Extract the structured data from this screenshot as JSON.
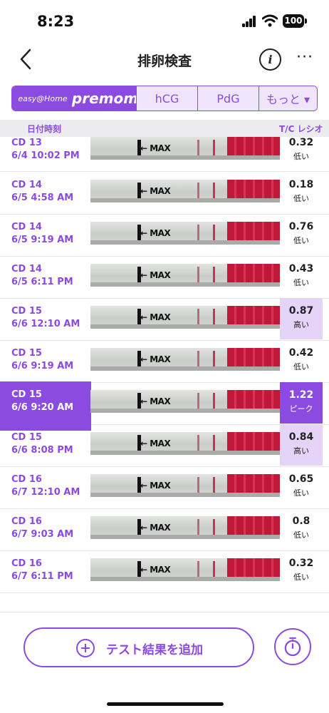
{
  "status_bar": {
    "time": "8:23",
    "battery": "100"
  },
  "header": {
    "title": "排卵検査",
    "info_label": "i",
    "more_label": "···"
  },
  "tabs": [
    {
      "label": "easy@Home",
      "active": true
    },
    {
      "label": "premom",
      "active": true
    },
    {
      "label": "hCG",
      "active": false
    },
    {
      "label": "PdG",
      "active": false
    },
    {
      "label": "もっと ▾",
      "active": false
    }
  ],
  "columns": {
    "date": "日付時刻",
    "ratio": "T/C レシオ"
  },
  "strip_text": {
    "max": "MAX"
  },
  "colors": {
    "accent": "#8c4be0",
    "high_bg": "#e6d4f8",
    "peak_bg": "#8c4be0"
  },
  "tests": [
    {
      "cd": "CD 13",
      "datetime": "6/4 10:02 PM",
      "ratio": "0.32",
      "status": "低い",
      "level": "low",
      "selected": false
    },
    {
      "cd": "CD 14",
      "datetime": "6/5 4:58 AM",
      "ratio": "0.18",
      "status": "低い",
      "level": "low",
      "selected": false
    },
    {
      "cd": "CD 14",
      "datetime": "6/5 9:19 AM",
      "ratio": "0.76",
      "status": "低い",
      "level": "low",
      "selected": false
    },
    {
      "cd": "CD 14",
      "datetime": "6/5 6:11 PM",
      "ratio": "0.43",
      "status": "低い",
      "level": "low",
      "selected": false
    },
    {
      "cd": "CD 15",
      "datetime": "6/6 12:10 AM",
      "ratio": "0.87",
      "status": "高い",
      "level": "high",
      "selected": false
    },
    {
      "cd": "CD 15",
      "datetime": "6/6 9:19 AM",
      "ratio": "0.42",
      "status": "低い",
      "level": "low",
      "selected": false
    },
    {
      "cd": "CD 15",
      "datetime": "6/6 9:20 AM",
      "ratio": "1.22",
      "status": "ピーク",
      "level": "peak",
      "selected": true
    },
    {
      "cd": "CD 15",
      "datetime": "6/6 8:08 PM",
      "ratio": "0.84",
      "status": "高い",
      "level": "high",
      "selected": false
    },
    {
      "cd": "CD 16",
      "datetime": "6/7 12:10 AM",
      "ratio": "0.65",
      "status": "低い",
      "level": "low",
      "selected": false
    },
    {
      "cd": "CD 16",
      "datetime": "6/7 9:03 AM",
      "ratio": "0.8",
      "status": "低い",
      "level": "low",
      "selected": false
    },
    {
      "cd": "CD 16",
      "datetime": "6/7 6:11 PM",
      "ratio": "0.32",
      "status": "低い",
      "level": "low",
      "selected": false
    }
  ],
  "add_button": {
    "label": "テスト結果を追加"
  }
}
